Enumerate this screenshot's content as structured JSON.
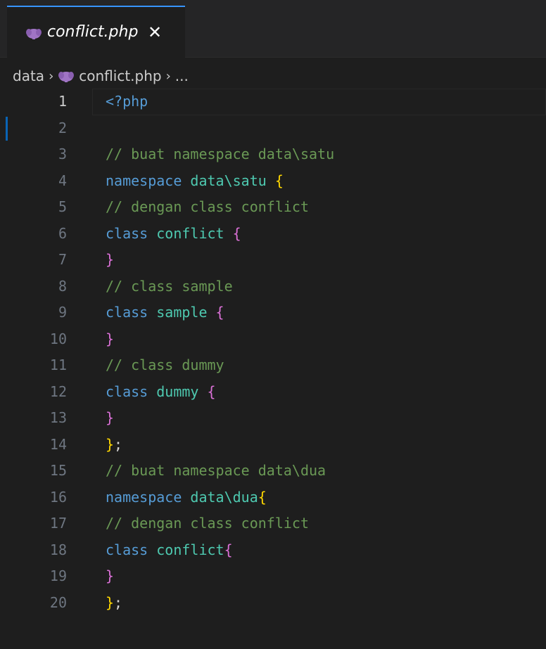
{
  "tab": {
    "title": "conflict.php",
    "close_glyph": "✕",
    "icon": "php-elephant-icon",
    "icon_color": "#a074c4"
  },
  "breadcrumb": {
    "segments": [
      "data",
      "conflict.php",
      "..."
    ],
    "separator": "›"
  },
  "colors": {
    "background": "#1e1e1e",
    "tab_accent": "#3794ff",
    "comment": "#6a9955",
    "keyword": "#569cd6",
    "type_name": "#4ec9b0",
    "bracket_yellow": "#ffd700",
    "bracket_purple": "#da70d6"
  },
  "editor": {
    "lines": [
      {
        "n": "1",
        "tokens": [
          {
            "t": "<?php",
            "c": "tag"
          }
        ]
      },
      {
        "n": "2",
        "tokens": []
      },
      {
        "n": "3",
        "tokens": [
          {
            "t": "// buat namespace data\\satu",
            "c": "comment"
          }
        ]
      },
      {
        "n": "4",
        "tokens": [
          {
            "t": "namespace ",
            "c": "keyword"
          },
          {
            "t": "data\\satu ",
            "c": "name"
          },
          {
            "t": "{",
            "c": "brace-y"
          }
        ]
      },
      {
        "n": "5",
        "tokens": [
          {
            "t": "// dengan class conflict",
            "c": "comment"
          }
        ]
      },
      {
        "n": "6",
        "tokens": [
          {
            "t": "class ",
            "c": "keyword"
          },
          {
            "t": "conflict ",
            "c": "name"
          },
          {
            "t": "{",
            "c": "brace-p"
          }
        ]
      },
      {
        "n": "7",
        "tokens": [
          {
            "t": "}",
            "c": "brace-p"
          }
        ]
      },
      {
        "n": "8",
        "tokens": [
          {
            "t": "// class sample",
            "c": "comment"
          }
        ]
      },
      {
        "n": "9",
        "tokens": [
          {
            "t": "class ",
            "c": "keyword"
          },
          {
            "t": "sample ",
            "c": "name"
          },
          {
            "t": "{",
            "c": "brace-p"
          }
        ]
      },
      {
        "n": "10",
        "tokens": [
          {
            "t": "}",
            "c": "brace-p"
          }
        ]
      },
      {
        "n": "11",
        "tokens": [
          {
            "t": "// class dummy",
            "c": "comment"
          }
        ]
      },
      {
        "n": "12",
        "tokens": [
          {
            "t": "class ",
            "c": "keyword"
          },
          {
            "t": "dummy ",
            "c": "name"
          },
          {
            "t": "{",
            "c": "brace-p"
          }
        ]
      },
      {
        "n": "13",
        "tokens": [
          {
            "t": "}",
            "c": "brace-p"
          }
        ]
      },
      {
        "n": "14",
        "tokens": [
          {
            "t": "}",
            "c": "brace-y"
          },
          {
            "t": ";",
            "c": "punct"
          }
        ]
      },
      {
        "n": "15",
        "tokens": [
          {
            "t": "// buat namespace data\\dua",
            "c": "comment"
          }
        ]
      },
      {
        "n": "16",
        "tokens": [
          {
            "t": "namespace ",
            "c": "keyword"
          },
          {
            "t": "data\\dua",
            "c": "name"
          },
          {
            "t": "{",
            "c": "brace-y"
          }
        ]
      },
      {
        "n": "17",
        "tokens": [
          {
            "t": "// dengan class conflict",
            "c": "comment"
          }
        ]
      },
      {
        "n": "18",
        "tokens": [
          {
            "t": "class ",
            "c": "keyword"
          },
          {
            "t": "conflict",
            "c": "name"
          },
          {
            "t": "{",
            "c": "brace-p"
          }
        ]
      },
      {
        "n": "19",
        "tokens": [
          {
            "t": "}",
            "c": "brace-p"
          }
        ]
      },
      {
        "n": "20",
        "tokens": [
          {
            "t": "}",
            "c": "brace-y"
          },
          {
            "t": ";",
            "c": "punct"
          }
        ]
      }
    ],
    "current_line": "1"
  }
}
